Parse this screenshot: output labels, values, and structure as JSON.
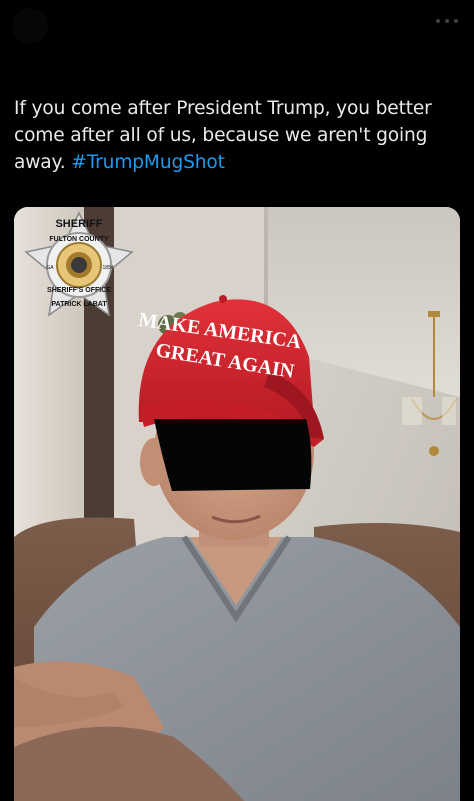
{
  "post": {
    "text_main": "If you come after President Trump, you better come after all of us, because we aren't going away. ",
    "hashtag": "#TrumpMugShot"
  },
  "media": {
    "badge": {
      "top": "SHERIFF",
      "county": "FULTON COUNTY",
      "office": "SHERIFF'S OFFICE",
      "name": "PATRICK LABAT",
      "left_tag": "GA",
      "right_tag": "1854"
    },
    "hat": {
      "line1": "MAKE AMERICA",
      "line2": "GREAT AGAIN"
    }
  },
  "icons": {
    "more": "more-horizontal-icon"
  },
  "colors": {
    "background": "#000000",
    "text": "#e7e9ea",
    "link": "#1d9bf0",
    "hat_red": "#d9262f",
    "shirt": "#8f949b"
  }
}
